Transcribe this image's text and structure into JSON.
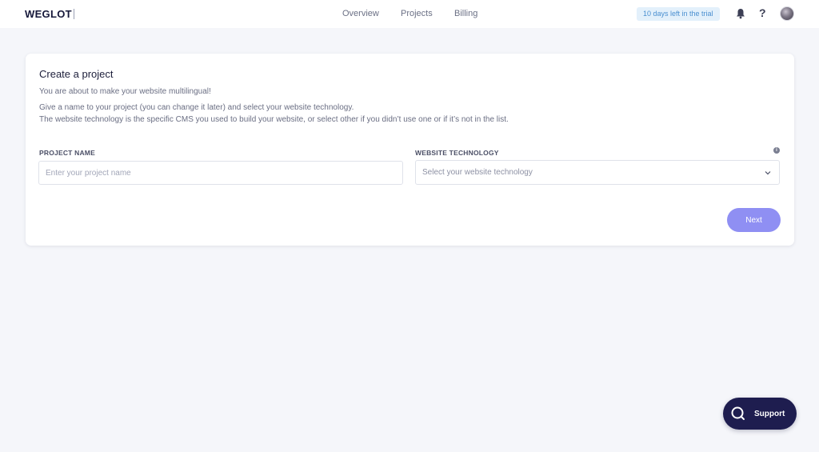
{
  "header": {
    "logo": "WEGLOT",
    "nav": [
      "Overview",
      "Projects",
      "Billing"
    ],
    "trial_badge": "10 days left in the trial",
    "help_label": "?"
  },
  "card": {
    "title": "Create a project",
    "intro": "You are about to make your website multilingual!",
    "line1": "Give a name to your project (you can change it later) and select your website technology.",
    "line2": "The website technology is the specific CMS you used to build your website, or select other if you didn’t use one or if it’s not in the list.",
    "project_name_label": "PROJECT NAME",
    "project_name_placeholder": "Enter your project name",
    "project_name_value": "",
    "technology_label": "WEBSITE TECHNOLOGY",
    "technology_placeholder": "Select your website technology",
    "info_icon": "i",
    "next_label": "Next"
  },
  "support": {
    "label": "Support"
  },
  "icons": {
    "bell": "bell-icon",
    "help": "question-icon",
    "avatar": "user-avatar",
    "info": "info-icon",
    "chevron": "chevron-down-icon",
    "support": "search-chat-icon"
  },
  "colors": {
    "accent": "#8f8ff3",
    "support_bg": "#1e1d4f",
    "badge_bg": "#e3f0fb",
    "badge_text": "#4a8fd0",
    "page_bg": "#f5f6fa"
  }
}
